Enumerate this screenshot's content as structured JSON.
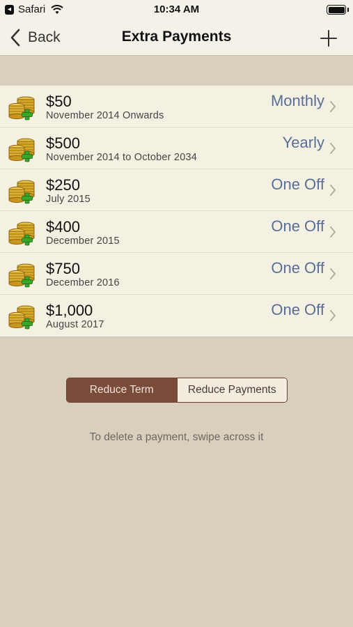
{
  "status_bar": {
    "back_badge": "◂",
    "app_name": "Safari",
    "time": "10:34 AM"
  },
  "nav": {
    "back_label": "Back",
    "title": "Extra Payments",
    "add_icon": "plus-icon"
  },
  "payments": [
    {
      "amount": "$50",
      "period": "November 2014 Onwards",
      "frequency": "Monthly"
    },
    {
      "amount": "$500",
      "period": "November 2014 to October 2034",
      "frequency": "Yearly"
    },
    {
      "amount": "$250",
      "period": "July 2015",
      "frequency": "One Off"
    },
    {
      "amount": "$400",
      "period": "December 2015",
      "frequency": "One Off"
    },
    {
      "amount": "$750",
      "period": "December 2016",
      "frequency": "One Off"
    },
    {
      "amount": "$1,000",
      "period": "August 2017",
      "frequency": "One Off"
    }
  ],
  "segmented": {
    "options": [
      "Reduce Term",
      "Reduce Payments"
    ],
    "selected": "Reduce Term"
  },
  "hint": "To delete a payment, swipe across it",
  "colors": {
    "background": "#d9cfbd",
    "frequency_text": "#5a6e96",
    "segment_active": "#7a4a3a"
  }
}
